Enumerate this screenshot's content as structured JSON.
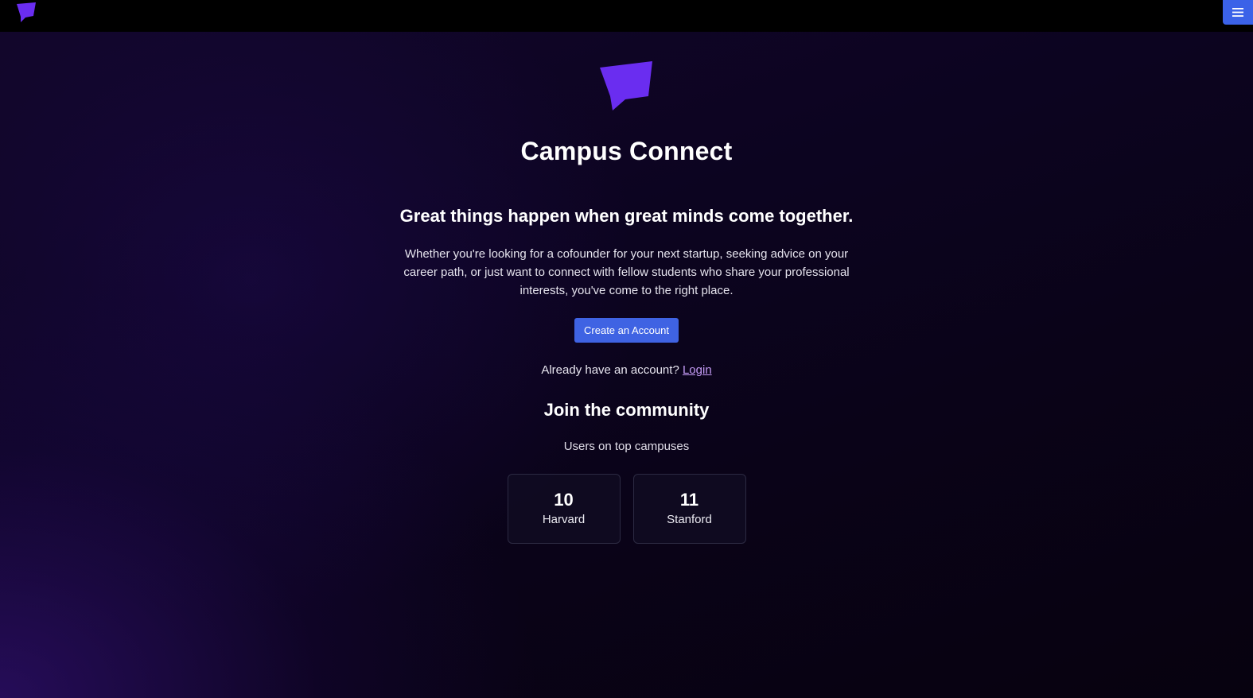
{
  "colors": {
    "brand_purple": "#6a2df0",
    "primary_button": "#3f63e3",
    "link": "#c49bf5",
    "navbar": "#000000"
  },
  "navbar": {
    "logo_icon": "speech-bubble-logo-icon",
    "menu_icon": "hamburger-menu-icon"
  },
  "hero": {
    "logo_icon": "speech-bubble-logo-icon",
    "title": "Campus Connect",
    "tagline": "Great things happen when great minds come together.",
    "description": "Whether you're looking for a cofounder for your next startup, seeking advice on your career path, or just want to connect with fellow students who share your professional interests, you've come to the right place.",
    "cta_label": "Create an Account",
    "login_prompt": "Already have an account?",
    "login_link": "Login"
  },
  "community": {
    "title": "Join the community",
    "subtitle": "Users on top campuses",
    "campuses": [
      {
        "count": "10",
        "name": "Harvard"
      },
      {
        "count": "11",
        "name": "Stanford"
      }
    ]
  }
}
